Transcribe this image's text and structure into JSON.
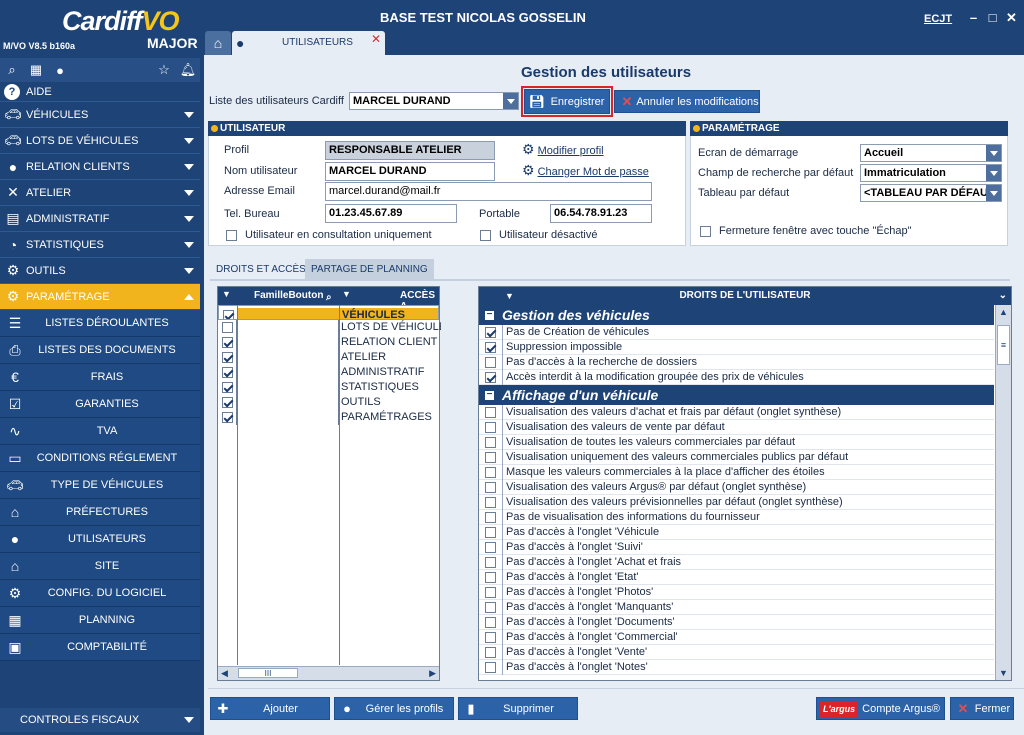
{
  "app": {
    "brand_main": "Cardiff",
    "brand_vo": "VO",
    "brand_sub": "MAJOR",
    "version": "M/VO V8.5 b160a",
    "title": "BASE TEST NICOLAS GOSSELIN",
    "user": "ECJT"
  },
  "tabs": {
    "active_label": "UTILISATEURS"
  },
  "sidebar": {
    "aide": "AIDE",
    "items": [
      {
        "label": "VÉHICULES",
        "icon": "car-icon"
      },
      {
        "label": "LOTS DE VÉHICULES",
        "icon": "car-icon"
      },
      {
        "label": "RELATION CLIENTS",
        "icon": "person-icon"
      },
      {
        "label": "ATELIER",
        "icon": "tools-icon"
      },
      {
        "label": "ADMINISTRATIF",
        "icon": "document-icon"
      },
      {
        "label": "STATISTIQUES",
        "icon": "pie-chart-icon"
      },
      {
        "label": "OUTILS",
        "icon": "gear-icon"
      },
      {
        "label": "PARAMÉTRAGE",
        "icon": "gear-icon"
      }
    ],
    "subitems": [
      {
        "label": "LISTES DÉROULANTES",
        "icon": "list-icon"
      },
      {
        "label": "LISTES DES DOCUMENTS",
        "icon": "printer-icon"
      },
      {
        "label": "FRAIS",
        "icon": "euro-icon"
      },
      {
        "label": "GARANTIES",
        "icon": "checkbox-icon"
      },
      {
        "label": "TVA",
        "icon": "chart-icon"
      },
      {
        "label": "CONDITIONS RÉGLEMENT",
        "icon": "card-icon"
      },
      {
        "label": "TYPE DE VÉHICULES",
        "icon": "car-icon"
      },
      {
        "label": "PRÉFECTURES",
        "icon": "bank-icon"
      },
      {
        "label": "UTILISATEURS",
        "icon": "person-icon"
      },
      {
        "label": "SITE",
        "icon": "home-icon"
      },
      {
        "label": "CONFIG. DU LOGICIEL",
        "icon": "gear-icon"
      },
      {
        "label": "PLANNING",
        "icon": "calendar-icon"
      },
      {
        "label": "COMPTABILITÉ",
        "icon": "wallet-icon"
      }
    ],
    "fiscaux": "CONTROLES FISCAUX"
  },
  "page": {
    "title": "Gestion des utilisateurs",
    "list_label": "Liste des utilisateurs Cardiff",
    "list_value": "MARCEL DURAND",
    "save_label": "Enregistrer",
    "cancel_label": "Annuler les modifications"
  },
  "user_section": {
    "title": "UTILISATEUR",
    "profil_label": "Profil",
    "profil_value": "RESPONSABLE ATELIER",
    "modifier_profil": "Modifier profil",
    "nom_label": "Nom utilisateur",
    "nom_value": "MARCEL DURAND",
    "changer_mdp": "Changer Mot de passe",
    "email_label": "Adresse Email",
    "email_value": "marcel.durand@mail.fr",
    "tel_label": "Tel. Bureau",
    "tel_value": "01.23.45.67.89",
    "portable_label": "Portable",
    "portable_value": "06.54.78.91.23",
    "consult_label": "Utilisateur en consultation uniquement",
    "desactive_label": "Utilisateur désactivé"
  },
  "param_section": {
    "title": "PARAMÉTRAGE",
    "ecran_label": "Ecran de démarrage",
    "ecran_value": "Accueil",
    "champ_label": "Champ de recherche par défaut",
    "champ_value": "Immatriculation",
    "tableau_label": "Tableau par défaut",
    "tableau_value": "<TABLEAU PAR DÉFAUT>",
    "fermeture_label": "Fermeture fenêtre avec touche \"Échap\""
  },
  "lower_tabs": {
    "droits": "DROITS ET ACCÈS",
    "planning": "PARTAGE DE PLANNING"
  },
  "left_grid": {
    "col1": "FamilleBouton",
    "col2": "ACCÈS A",
    "rows": [
      {
        "checked": true,
        "label": "VÉHICULES",
        "selected": true
      },
      {
        "checked": false,
        "label": "LOTS DE VÉHICULES",
        "selected": false
      },
      {
        "checked": true,
        "label": "RELATION CLIENT",
        "selected": false
      },
      {
        "checked": true,
        "label": "ATELIER",
        "selected": false
      },
      {
        "checked": true,
        "label": "ADMINISTRATIF",
        "selected": false
      },
      {
        "checked": true,
        "label": "STATISTIQUES",
        "selected": false
      },
      {
        "checked": true,
        "label": "OUTILS",
        "selected": false
      },
      {
        "checked": true,
        "label": "PARAMÉTRAGES",
        "selected": false
      }
    ],
    "scroll_thumb": "III"
  },
  "right_grid": {
    "header": "DROITS DE L'UTILISATEUR",
    "groups": [
      {
        "title": "Gestion des véhicules",
        "rows": [
          {
            "checked": true,
            "label": "Pas de Création de véhicules"
          },
          {
            "checked": true,
            "label": "Suppression impossible"
          },
          {
            "checked": false,
            "label": "Pas d'accès à la recherche de dossiers"
          },
          {
            "checked": true,
            "label": "Accès interdit à la modification groupée des prix de véhicules"
          }
        ]
      },
      {
        "title": "Affichage d'un véhicule",
        "rows": [
          {
            "checked": false,
            "label": "Visualisation des valeurs d'achat et frais par défaut (onglet synthèse)"
          },
          {
            "checked": false,
            "label": "Visualisation des valeurs de vente par défaut"
          },
          {
            "checked": false,
            "label": "Visualisation de toutes les valeurs commerciales par défaut"
          },
          {
            "checked": false,
            "label": "Visualisation uniquement des valeurs commerciales publics par défaut"
          },
          {
            "checked": false,
            "label": "Masque les valeurs commerciales à la place d'afficher des étoiles"
          },
          {
            "checked": false,
            "label": "Visualisation des valeurs Argus® par défaut (onglet synthèse)"
          },
          {
            "checked": false,
            "label": "Visualisation des valeurs prévisionnelles par défaut (onglet synthèse)"
          },
          {
            "checked": false,
            "label": "Pas de visualisation des informations du fournisseur"
          },
          {
            "checked": false,
            "label": "Pas d'accès à l'onglet 'Véhicule"
          },
          {
            "checked": false,
            "label": "Pas d'accès à l'onglet 'Suivi'"
          },
          {
            "checked": false,
            "label": "Pas d'accès à l'onglet 'Achat et frais"
          },
          {
            "checked": false,
            "label": "Pas d'accès à l'onglet 'Etat'"
          },
          {
            "checked": false,
            "label": "Pas d'accès à l'onglet 'Photos'"
          },
          {
            "checked": false,
            "label": "Pas d'accès à l'onglet 'Manquants'"
          },
          {
            "checked": false,
            "label": "Pas d'accès à l'onglet 'Documents'"
          },
          {
            "checked": false,
            "label": "Pas d'accès à l'onglet 'Commercial'"
          },
          {
            "checked": false,
            "label": "Pas d'accès à l'onglet 'Vente'"
          },
          {
            "checked": false,
            "label": "Pas d'accès à l'onglet 'Notes'"
          }
        ]
      }
    ]
  },
  "bottom": {
    "ajouter": "Ajouter",
    "gerer": "Gérer les profils",
    "supprimer": "Supprimer",
    "argus_logo": "L'argus",
    "argus": "Compte Argus®",
    "fermer": "Fermer"
  },
  "colors": {
    "nav_bg": "#1e4377",
    "accent": "#f2b41c",
    "button": "#2c62a8",
    "highlight_border": "#d9252a"
  }
}
